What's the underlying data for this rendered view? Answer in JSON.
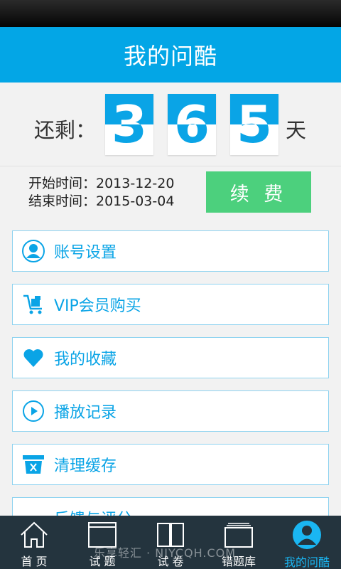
{
  "header": {
    "title": "我的问酷"
  },
  "remaining": {
    "label": "还剩：",
    "digits": [
      "3",
      "6",
      "5"
    ],
    "unit": "天"
  },
  "subscription": {
    "start": "开始时间：2013-12-20",
    "end": "结束时间：2015-03-04",
    "renew_label": "续 费"
  },
  "menu": [
    {
      "label": "账号设置",
      "icon": "user-icon"
    },
    {
      "label": "VIP会员购买",
      "icon": "cart-icon"
    },
    {
      "label": "我的收藏",
      "icon": "heart-icon"
    },
    {
      "label": "播放记录",
      "icon": "play-icon"
    },
    {
      "label": "清理缓存",
      "icon": "clear-cache-icon"
    },
    {
      "label": "反馈与评分",
      "icon": "feedback-icon"
    }
  ],
  "tabs": [
    {
      "label": "首 页",
      "icon": "home-icon"
    },
    {
      "label": "试 题",
      "icon": "quiz-icon"
    },
    {
      "label": "试 卷",
      "icon": "paper-icon"
    },
    {
      "label": "错题库",
      "icon": "mistakes-icon"
    },
    {
      "label": "我的问酷",
      "icon": "profile-icon",
      "active": true
    }
  ],
  "watermark": "乐享轻汇 · NJYCQH.COM",
  "colors": {
    "primary": "#03a6e6",
    "renew": "#4cd07d",
    "tabbar": "#24343e"
  }
}
